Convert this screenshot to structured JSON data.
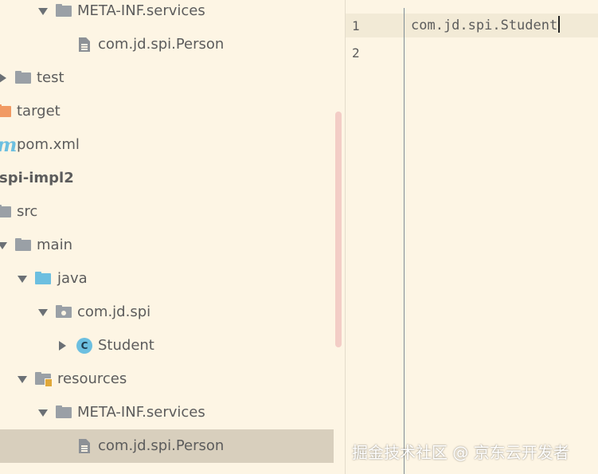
{
  "project_tree": {
    "items": [
      {
        "label": "META-INF.services",
        "icon": "folder-icon",
        "expanded": true
      },
      {
        "label": "com.jd.spi.Person",
        "icon": "file-icon"
      },
      {
        "label": "test",
        "icon": "folder-icon",
        "expanded": false
      },
      {
        "label": "target",
        "icon": "folder-orange-icon"
      },
      {
        "label": "pom.xml",
        "icon": "maven-icon"
      },
      {
        "label": "spi-impl2",
        "icon": "module"
      },
      {
        "label": "src",
        "icon": "folder-icon"
      },
      {
        "label": "main",
        "icon": "folder-icon",
        "expanded": true
      },
      {
        "label": "java",
        "icon": "source-folder-icon",
        "expanded": true
      },
      {
        "label": "com.jd.spi",
        "icon": "package-icon",
        "expanded": true
      },
      {
        "label": "Student",
        "icon": "class-icon",
        "class_letter": "C",
        "expanded": false
      },
      {
        "label": "resources",
        "icon": "resources-folder-icon",
        "expanded": true
      },
      {
        "label": "META-INF.services",
        "icon": "folder-icon",
        "expanded": true
      },
      {
        "label": "com.jd.spi.Person",
        "icon": "file-icon",
        "selected": true
      }
    ]
  },
  "editor": {
    "line_numbers": [
      "1",
      "2"
    ],
    "lines": [
      "com.jd.spi.Student",
      ""
    ]
  },
  "watermark": "掘金技术社区 @ 京东云开发者",
  "colors": {
    "background": "#fdf5e4",
    "folder": "#9aa0a6",
    "source_folder": "#6cbfe0",
    "target_folder": "#f19a63",
    "selection": "#d8cfbd",
    "scrollbar": "#f3cdc6"
  }
}
